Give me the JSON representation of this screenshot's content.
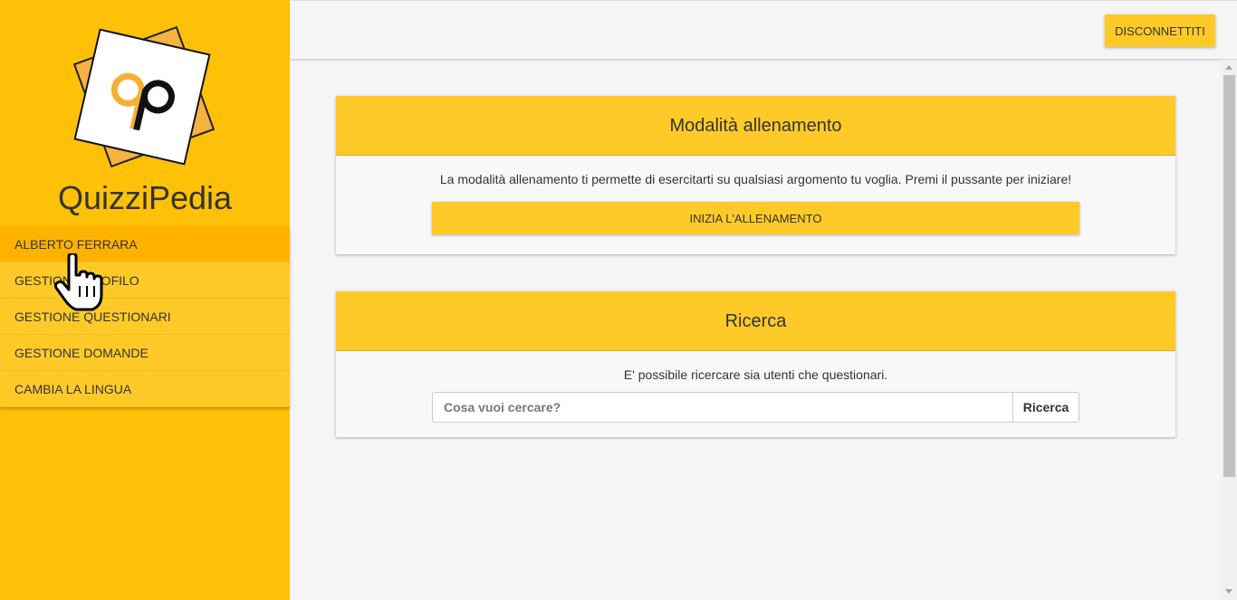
{
  "app": {
    "name": "QuizziPedia",
    "logo_letters": "qp"
  },
  "sidebar": {
    "items": [
      {
        "label": "ALBERTO FERRARA"
      },
      {
        "label": "GESTIONE PROFILO"
      },
      {
        "label": "GESTIONE QUESTIONARI"
      },
      {
        "label": "GESTIONE DOMANDE"
      },
      {
        "label": "CAMBIA LA LINGUA"
      }
    ]
  },
  "header": {
    "logout_label": "DISCONNETTITI"
  },
  "training": {
    "title": "Modalità allenamento",
    "description": "La modalità allenamento ti permette di esercitarti su qualsiasi argomento tu voglia. Premi il pussante per iniziare!",
    "button_label": "INIZIA L'ALLENAMENTO"
  },
  "search": {
    "title": "Ricerca",
    "description": "E' possibile ricercare sia utenti che questionari.",
    "placeholder": "Cosa vuoi cercare?",
    "button_label": "Ricerca"
  },
  "colors": {
    "primary": "#ffc107",
    "accent": "#ffca28",
    "active": "#ffb300"
  },
  "icons": {
    "cursor": "hand-pointer-icon"
  }
}
